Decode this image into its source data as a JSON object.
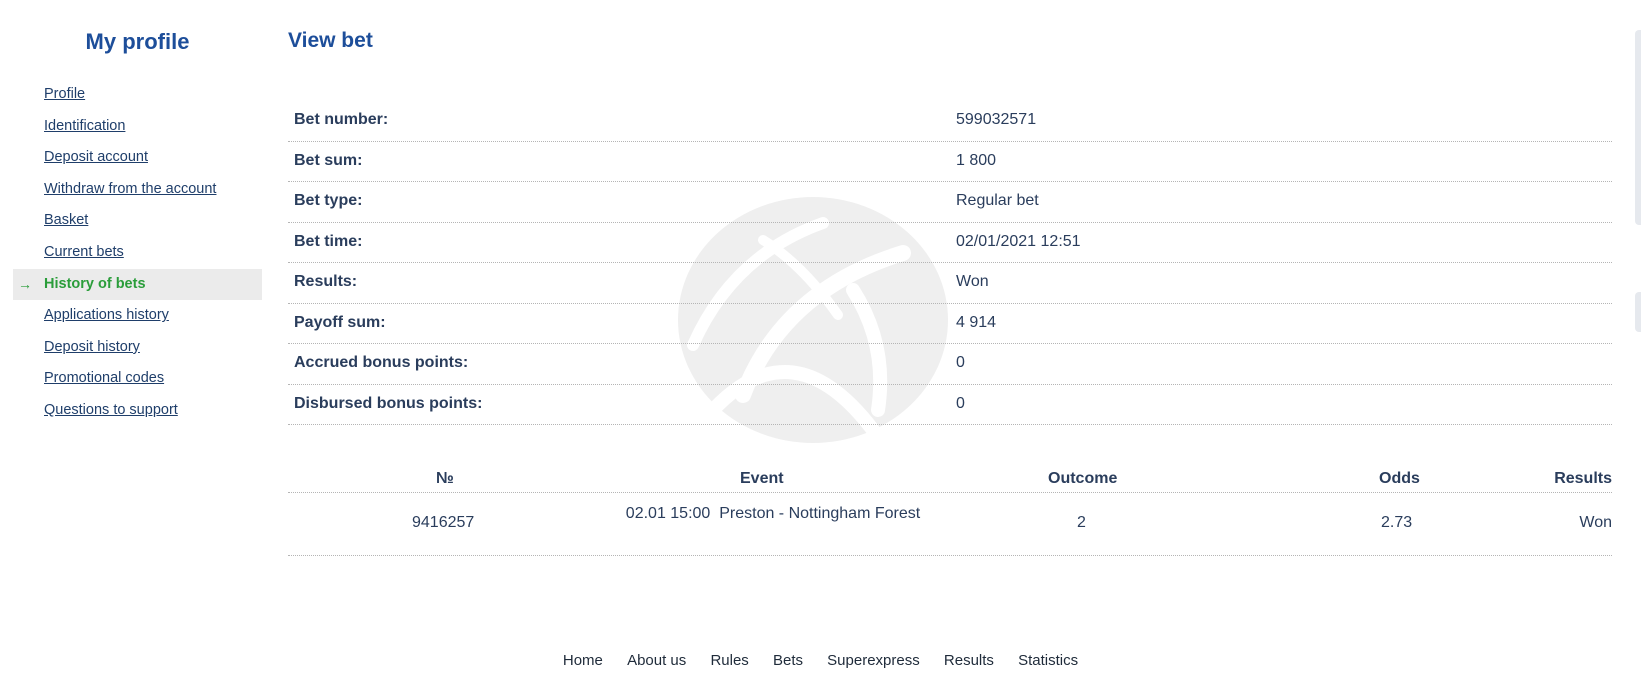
{
  "sidebar": {
    "title": "My profile",
    "items": [
      {
        "label": "Profile",
        "active": false
      },
      {
        "label": "Identification",
        "active": false
      },
      {
        "label": "Deposit account",
        "active": false
      },
      {
        "label": "Withdraw from the account",
        "active": false
      },
      {
        "label": "Basket",
        "active": false
      },
      {
        "label": "Current bets",
        "active": false
      },
      {
        "label": "History of bets",
        "active": true
      },
      {
        "label": "Applications history",
        "active": false
      },
      {
        "label": "Deposit history",
        "active": false
      },
      {
        "label": "Promotional codes",
        "active": false
      },
      {
        "label": "Questions to support",
        "active": false
      }
    ],
    "active_indicator": "→"
  },
  "main": {
    "title": "View bet",
    "details": [
      {
        "label": "Bet number:",
        "value": "599032571"
      },
      {
        "label": "Bet sum:",
        "value": "1 800"
      },
      {
        "label": "Bet type:",
        "value": "Regular bet"
      },
      {
        "label": "Bet time:",
        "value": "02/01/2021 12:51"
      },
      {
        "label": "Results:",
        "value": "Won"
      },
      {
        "label": "Payoff sum:",
        "value": "4 914"
      },
      {
        "label": "Accrued bonus points:",
        "value": "0"
      },
      {
        "label": "Disbursed bonus points:",
        "value": "0"
      }
    ],
    "events_table": {
      "headers": {
        "number": "№",
        "event": "Event",
        "outcome": "Outcome",
        "odds": "Odds",
        "results": "Results"
      },
      "rows": [
        {
          "number": "9416257",
          "event_time": "02.01 15:00",
          "event_name": "Preston - Nottingham Forest",
          "outcome": "2",
          "odds": "2.73",
          "results": "Won"
        }
      ]
    }
  },
  "footer": {
    "links": [
      "Home",
      "About us",
      "Rules",
      "Bets",
      "Superexpress",
      "Results",
      "Statistics"
    ]
  },
  "colors": {
    "brand_blue": "#1d4e9a",
    "active_green": "#2a9d3a",
    "text": "#2a3d5c"
  }
}
